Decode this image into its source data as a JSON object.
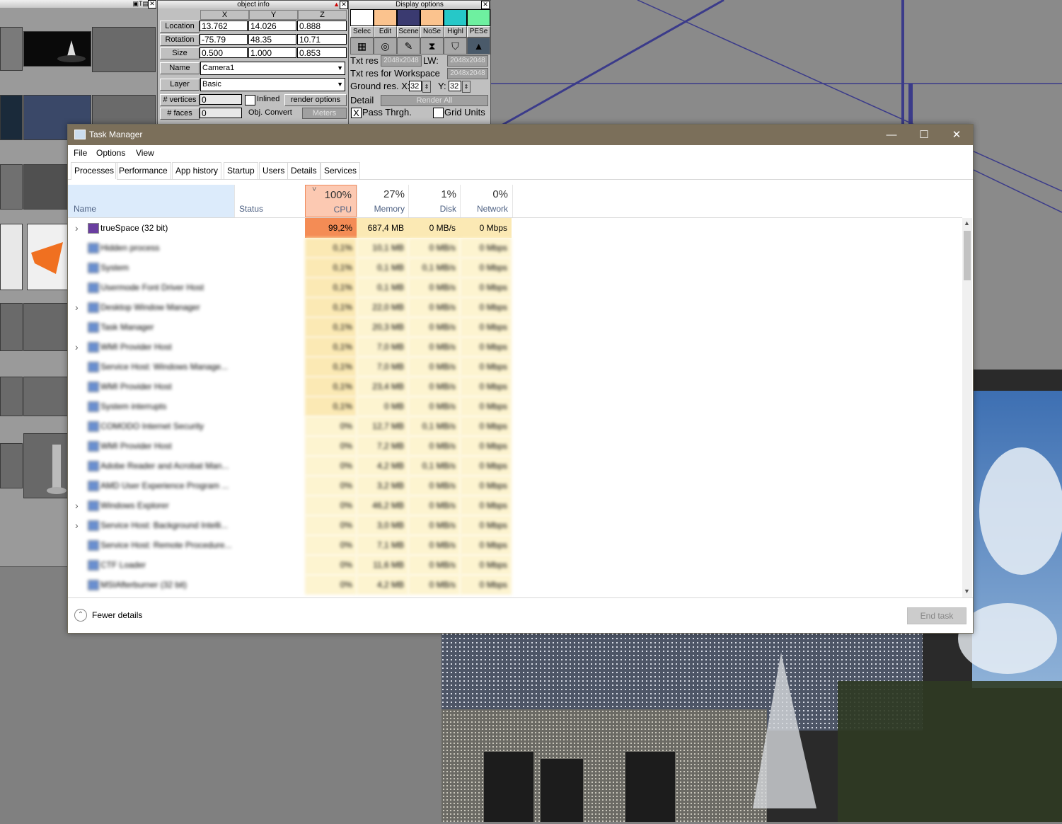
{
  "object_info": {
    "title": "object info",
    "col_x": "X",
    "col_y": "Y",
    "col_z": "Z",
    "location_label": "Location",
    "location": [
      "13.762",
      "14.026",
      "0.888"
    ],
    "rotation_label": "Rotation",
    "rotation": [
      "-75.79",
      "48.35",
      "10.71"
    ],
    "size_label": "Size",
    "size": [
      "0.500",
      "1.000",
      "0.853"
    ],
    "name_label": "Name",
    "name_value": "Camera1",
    "layer_label": "Layer",
    "layer_value": "Basic",
    "vertices_label": "# vertices",
    "vertices_value": "0",
    "inlined_label": "Inlined",
    "render_options_label": "render options",
    "faces_label": "# faces",
    "faces_value": "0",
    "obj_convert_label": "Obj. Convert",
    "meters_label": "Meters"
  },
  "display_options": {
    "title": "Display options",
    "swatch_colors": [
      "#ffffff",
      "#fbc38e",
      "#3a3a70",
      "#fbc38e",
      "#26c8c8",
      "#6ef0a0"
    ],
    "tabs": [
      "Selec",
      "Edit",
      "Scene",
      "NoSe",
      "Highl",
      "PESe"
    ],
    "txt_res_label": "Txt res",
    "txt_res_value": "2048x2048",
    "lw_label": "LW:",
    "lw_value": "2048x2048",
    "txt_res_ws_label": "Txt res for Workspace",
    "txt_res_ws_value": "2048x2048",
    "ground_res_label": "Ground res. X:",
    "ground_x": "32",
    "ground_y_label": "Y:",
    "ground_y": "32",
    "detail_label": "Detail",
    "render_all_label": "Render All",
    "pass_thrgh_label": "Pass Thrgh.",
    "pass_thrgh_checked": "X",
    "grid_units_label": "Grid Units"
  },
  "task_manager": {
    "title": "Task Manager",
    "menu": [
      "File",
      "Options",
      "View"
    ],
    "tabs": [
      "Processes",
      "Performance",
      "App history",
      "Startup",
      "Users",
      "Details",
      "Services"
    ],
    "active_tab": "Processes",
    "columns": {
      "name": "Name",
      "status": "Status",
      "cpu_pct": "100%",
      "cpu": "CPU",
      "memory_pct": "27%",
      "memory": "Memory",
      "disk_pct": "1%",
      "disk": "Disk",
      "network_pct": "0%",
      "network": "Network"
    },
    "sort_arrow": "˅",
    "rows": [
      {
        "name": "trueSpace (32 bit)",
        "cpu": "99,2%",
        "memory": "687,4 MB",
        "disk": "0 MB/s",
        "network": "0 Mbps"
      },
      {
        "name": "Hidden process",
        "cpu": "0,1%",
        "memory": "10,1 MB",
        "disk": "0 MB/s",
        "network": "0 Mbps"
      },
      {
        "name": "System",
        "cpu": "0,1%",
        "memory": "0,1 MB",
        "disk": "0,1 MB/s",
        "network": "0 Mbps"
      },
      {
        "name": "Usermode Font Driver Host",
        "cpu": "0,1%",
        "memory": "0,1 MB",
        "disk": "0 MB/s",
        "network": "0 Mbps"
      },
      {
        "name": "Desktop Window Manager",
        "cpu": "0,1%",
        "memory": "22,0 MB",
        "disk": "0 MB/s",
        "network": "0 Mbps"
      },
      {
        "name": "Task Manager",
        "cpu": "0,1%",
        "memory": "20,3 MB",
        "disk": "0 MB/s",
        "network": "0 Mbps"
      },
      {
        "name": "WMI Provider Host",
        "cpu": "0,1%",
        "memory": "7,0 MB",
        "disk": "0 MB/s",
        "network": "0 Mbps"
      },
      {
        "name": "Service Host: Windows Manage...",
        "cpu": "0,1%",
        "memory": "7,0 MB",
        "disk": "0 MB/s",
        "network": "0 Mbps"
      },
      {
        "name": "WMI Provider Host",
        "cpu": "0,1%",
        "memory": "23,4 MB",
        "disk": "0 MB/s",
        "network": "0 Mbps"
      },
      {
        "name": "System interrupts",
        "cpu": "0,1%",
        "memory": "0 MB",
        "disk": "0 MB/s",
        "network": "0 Mbps"
      },
      {
        "name": "COMODO Internet Security",
        "cpu": "0%",
        "memory": "12,7 MB",
        "disk": "0,1 MB/s",
        "network": "0 Mbps"
      },
      {
        "name": "WMI Provider Host",
        "cpu": "0%",
        "memory": "7,2 MB",
        "disk": "0 MB/s",
        "network": "0 Mbps"
      },
      {
        "name": "Adobe Reader and Acrobat Man...",
        "cpu": "0%",
        "memory": "4,2 MB",
        "disk": "0,1 MB/s",
        "network": "0 Mbps"
      },
      {
        "name": "AMD User Experience Program ...",
        "cpu": "0%",
        "memory": "3,2 MB",
        "disk": "0 MB/s",
        "network": "0 Mbps"
      },
      {
        "name": "Windows Explorer",
        "cpu": "0%",
        "memory": "46,2 MB",
        "disk": "0 MB/s",
        "network": "0 Mbps"
      },
      {
        "name": "Service Host: Background Intelli...",
        "cpu": "0%",
        "memory": "3,0 MB",
        "disk": "0 MB/s",
        "network": "0 Mbps"
      },
      {
        "name": "Service Host: Remote Procedure...",
        "cpu": "0%",
        "memory": "7,1 MB",
        "disk": "0 MB/s",
        "network": "0 Mbps"
      },
      {
        "name": "CTF Loader",
        "cpu": "0%",
        "memory": "11,6 MB",
        "disk": "0 MB/s",
        "network": "0 Mbps"
      },
      {
        "name": "MSIAfterburner (32 bit)",
        "cpu": "0%",
        "memory": "4,2 MB",
        "disk": "0 MB/s",
        "network": "0 Mbps"
      }
    ],
    "fewer_details": "Fewer details",
    "end_task": "End task"
  }
}
